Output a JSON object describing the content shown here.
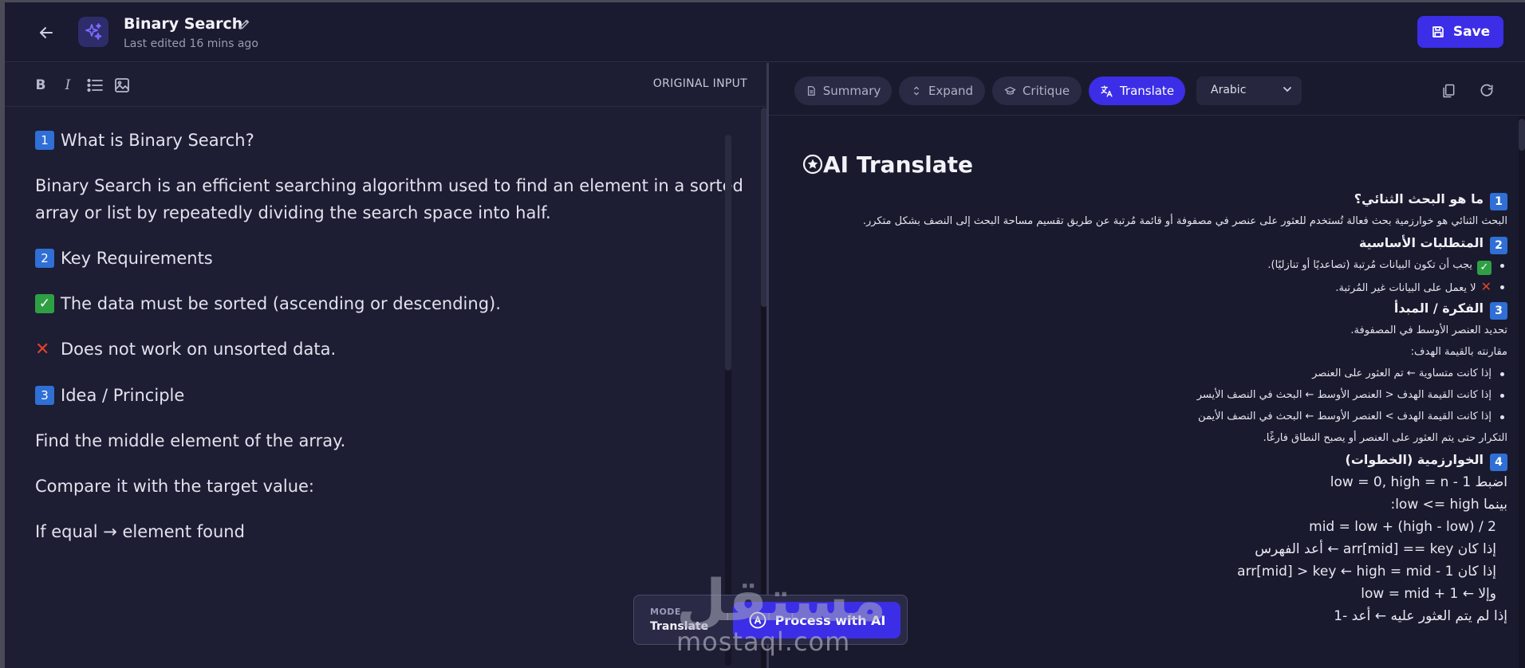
{
  "header": {
    "title": "Binary Search",
    "last_edited": "Last edited 16 mins ago",
    "save_label": "Save"
  },
  "left": {
    "original_input_label": "ORIGINAL INPUT",
    "toolbar": [
      "bold-icon",
      "italic-icon",
      "bullet-list-icon",
      "image-icon"
    ],
    "lines": {
      "h1_num": "1",
      "h1": "What is Binary Search?",
      "p1a": "Binary Search is an efficient searching algorithm used to find an element in a sorted",
      "p1b": "array or list by repeatedly dividing the search space into half.",
      "h2_num": "2",
      "h2": "Key Requirements",
      "req1": "The data must be sorted (ascending or descending).",
      "req2": "Does not work on unsorted data.",
      "h3_num": "3",
      "h3": "Idea / Principle",
      "idea1": "Find the middle element of the array.",
      "idea2": "Compare it with the target value:",
      "idea3": "If equal → element found"
    }
  },
  "right": {
    "modes": [
      "Summary",
      "Expand",
      "Critique",
      "Translate"
    ],
    "active_mode": "Translate",
    "language": "Arabic",
    "ai_title": "AI Translate",
    "content": {
      "h1_num": "1",
      "h1": "ما هو البحث الثنائي؟",
      "p1": "البحث الثنائي هو خوارزمية بحث فعالة تُستخدم للعثور على عنصر في مصفوفة أو قائمة مُرتبة عن طريق تقسيم مساحة البحث إلى النصف بشكل متكرر.",
      "h2_num": "2",
      "h2": "المتطلبات الأساسية",
      "req1": "يجب أن تكون البيانات مُرتبة (تصاعديًا أو تنازليًا).",
      "req2": "لا يعمل على البيانات غير المُرتبة.",
      "h3_num": "3",
      "h3": "الفكرة / المبدأ",
      "idea1": "تحديد العنصر الأوسط في المصفوفة.",
      "idea2": "مقارنته بالقيمة الهدف:",
      "li1": "إذا كانت متساوية ← تم العثور على العنصر",
      "li2": "إذا كانت القيمة الهدف < العنصر الأوسط ← البحث في النصف الأيسر",
      "li3": "إذا كانت القيمة الهدف > العنصر الأوسط ← البحث في النصف الأيمن",
      "idea3": "التكرار حتى يتم العثور على العنصر أو يصبح النطاق فارغًا.",
      "h4_num": "4",
      "h4": "الخوارزمية (الخطوات)",
      "s1": "اضبط low = 0, high = n - 1",
      "s2": "بينما low <= high:",
      "s3": "mid = low + (high - low) / 2",
      "s4": "إذا كان arr[mid] == key ← أعد الفهرس",
      "s5": "إذا كان arr[mid] > key ← high = mid - 1",
      "s6": "وإلا ← low = mid + 1",
      "s7": "إذا لم يتم العثور عليه ← أعد -1"
    }
  },
  "float_bar": {
    "mode_caption": "MODE",
    "mode_value": "Translate",
    "process_label": "Process with AI"
  },
  "watermark": {
    "arabic": "مستقل",
    "latin": "mostaql.com"
  },
  "colors": {
    "accent": "#3b2ee6",
    "background": "#1b1b2f",
    "keycap": "#2f6fd6",
    "check": "#2ea043",
    "cross": "#e0442a"
  }
}
